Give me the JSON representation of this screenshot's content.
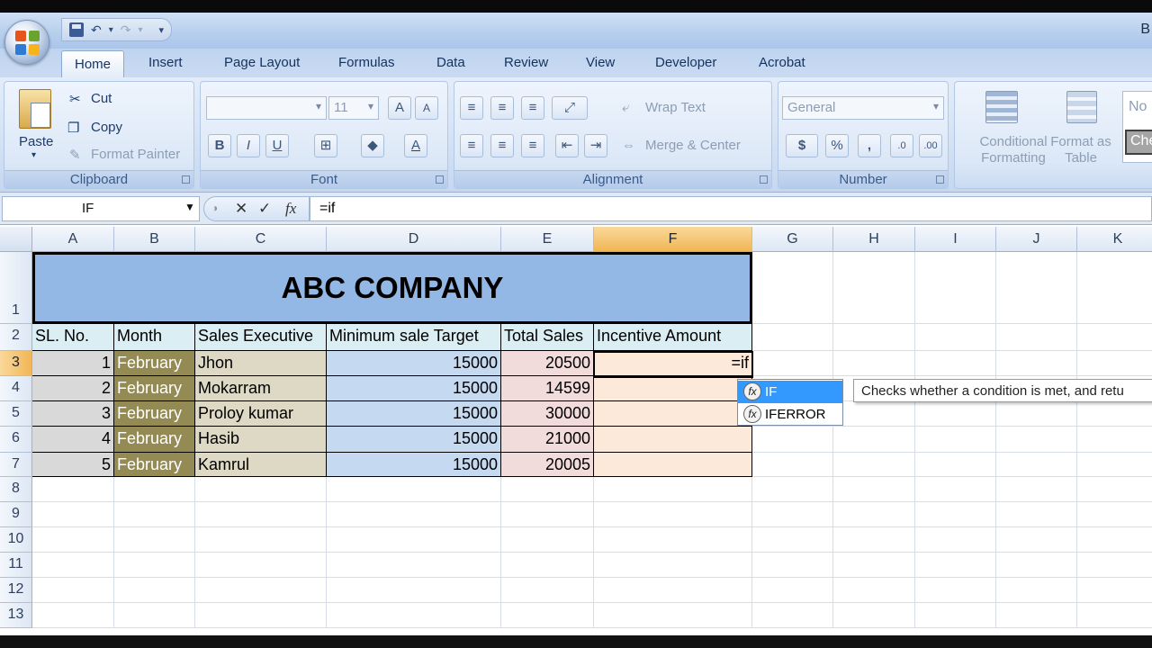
{
  "window": {
    "title_fragment": "B"
  },
  "tabs": [
    "Home",
    "Insert",
    "Page Layout",
    "Formulas",
    "Data",
    "Review",
    "View",
    "Developer",
    "Acrobat"
  ],
  "clipboard": {
    "label": "Clipboard",
    "paste": "Paste",
    "cut": "Cut",
    "copy": "Copy",
    "format_painter": "Format Painter"
  },
  "font": {
    "label": "Font",
    "name_value": "",
    "size_value": "11",
    "bold": "B",
    "italic": "I",
    "underline": "U"
  },
  "alignment": {
    "label": "Alignment",
    "wrap_text": "Wrap Text",
    "merge_center": "Merge & Center"
  },
  "number": {
    "label": "Number",
    "format_value": "General",
    "currency": "$",
    "percent": "%",
    "comma": ","
  },
  "styles": {
    "conditional_formatting": "Conditional Formatting",
    "format_as_table": "Format as Table",
    "cell_style_1": "No",
    "cell_style_2": "Che"
  },
  "formula_bar": {
    "name_box": "IF",
    "content": "=if",
    "fx": "fx"
  },
  "columns": [
    "A",
    "B",
    "C",
    "D",
    "E",
    "F",
    "G",
    "H",
    "I",
    "J",
    "K"
  ],
  "rows": [
    "1",
    "2",
    "3",
    "4",
    "5",
    "6",
    "7",
    "8",
    "9",
    "10",
    "11",
    "12",
    "13"
  ],
  "sheet": {
    "title": "ABC COMPANY",
    "headers": [
      "SL. No.",
      "Month",
      "Sales Executive",
      "Minimum sale Target",
      "Total Sales",
      "Incentive Amount"
    ],
    "data": [
      [
        "1",
        "February",
        "Jhon",
        "15000",
        "20500",
        "=if"
      ],
      [
        "2",
        "February",
        "Mokarram",
        "15000",
        "14599",
        ""
      ],
      [
        "3",
        "February",
        "Proloy kumar",
        "15000",
        "30000",
        ""
      ],
      [
        "4",
        "February",
        "Hasib",
        "15000",
        "21000",
        ""
      ],
      [
        "5",
        "February",
        "Kamrul",
        "15000",
        "20005",
        ""
      ]
    ]
  },
  "autocomplete": {
    "items": [
      "IF",
      "IFERROR"
    ],
    "tooltip": "Checks whether a condition is met, and retu"
  },
  "colors": {
    "title_fill": "#94b8e6",
    "sl_fill": "#d9d9d9",
    "month_fill": "#948a54",
    "exec_fill": "#ddd9c4",
    "target_fill": "#c5d9f1",
    "sales_fill": "#f2dcdb",
    "incentive_fill": "#fde9d9",
    "header_fill": "#daeef3"
  }
}
